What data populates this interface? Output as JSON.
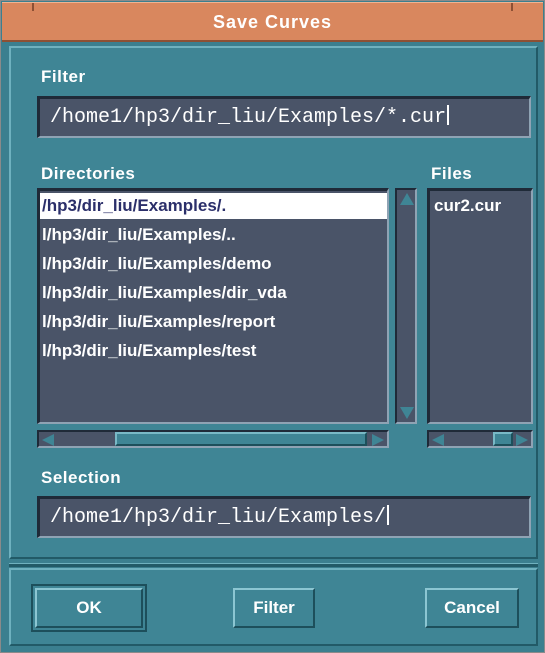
{
  "dialog": {
    "title": "Save Curves"
  },
  "filter": {
    "label": "Filter",
    "value": "/home1/hp3/dir_liu/Examples/*.cur"
  },
  "directories": {
    "label": "Directories",
    "items": [
      "/hp3/dir_liu/Examples/.",
      "l/hp3/dir_liu/Examples/..",
      "l/hp3/dir_liu/Examples/demo",
      "l/hp3/dir_liu/Examples/dir_vda",
      "l/hp3/dir_liu/Examples/report",
      "l/hp3/dir_liu/Examples/test"
    ],
    "selected_index": 0
  },
  "files": {
    "label": "Files",
    "items": [
      "cur2.cur"
    ]
  },
  "selection": {
    "label": "Selection",
    "value": "/home1/hp3/dir_liu/Examples/"
  },
  "buttons": {
    "ok": "OK",
    "filter": "Filter",
    "cancel": "Cancel"
  },
  "colors": {
    "title_bar": "#d9875e",
    "panel": "#3f8595",
    "field": "#4a5468",
    "text": "#ffffff"
  }
}
